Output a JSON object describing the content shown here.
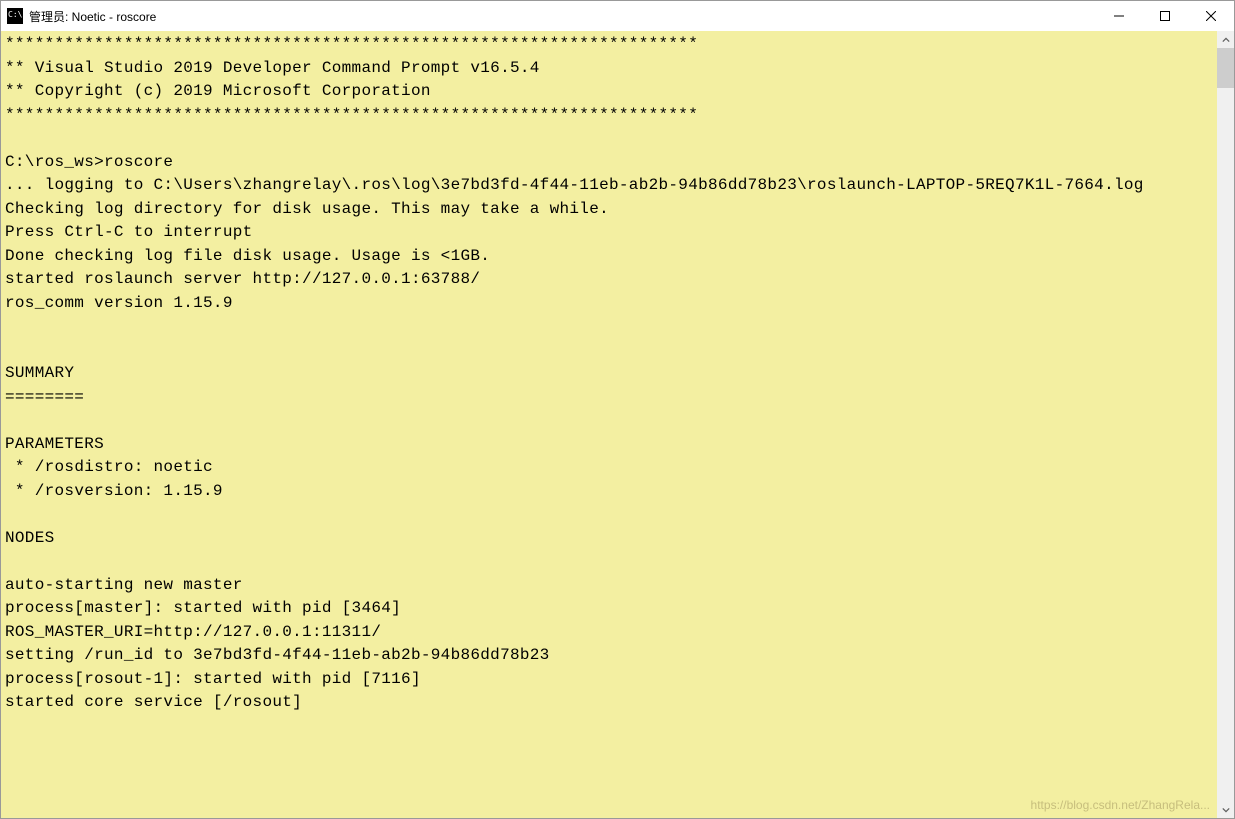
{
  "window": {
    "title": "管理员: Noetic - roscore"
  },
  "terminal": {
    "lines": [
      "**********************************************************************",
      "** Visual Studio 2019 Developer Command Prompt v16.5.4",
      "** Copyright (c) 2019 Microsoft Corporation",
      "**********************************************************************",
      "",
      "C:\\ros_ws>roscore",
      "... logging to C:\\Users\\zhangrelay\\.ros\\log\\3e7bd3fd-4f44-11eb-ab2b-94b86dd78b23\\roslaunch-LAPTOP-5REQ7K1L-7664.log",
      "Checking log directory for disk usage. This may take a while.",
      "Press Ctrl-C to interrupt",
      "Done checking log file disk usage. Usage is <1GB.",
      "started roslaunch server http://127.0.0.1:63788/",
      "ros_comm version 1.15.9",
      "",
      "",
      "SUMMARY",
      "========",
      "",
      "PARAMETERS",
      " * /rosdistro: noetic",
      " * /rosversion: 1.15.9",
      "",
      "NODES",
      "",
      "auto-starting new master",
      "process[master]: started with pid [3464]",
      "ROS_MASTER_URI=http://127.0.0.1:11311/",
      "setting /run_id to 3e7bd3fd-4f44-11eb-ab2b-94b86dd78b23",
      "process[rosout-1]: started with pid [7116]",
      "started core service [/rosout]"
    ]
  },
  "watermark": "https://blog.csdn.net/ZhangRela..."
}
